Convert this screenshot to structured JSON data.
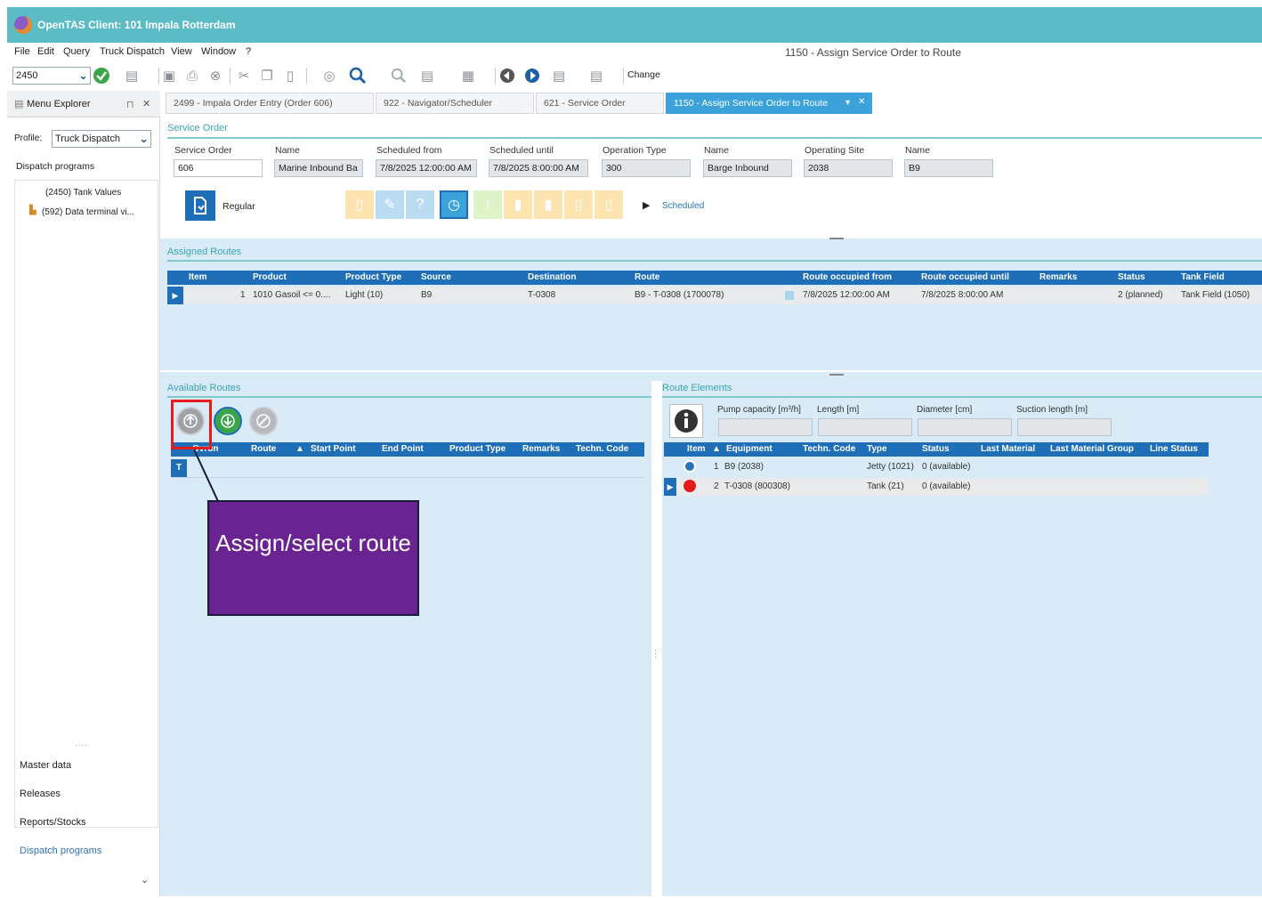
{
  "window": {
    "title": "OpenTAS  Client: 101 Impala Rotterdam"
  },
  "menu": {
    "items": [
      "File",
      "Edit",
      "Query",
      "Truck Dispatch",
      "View",
      "Window",
      "?"
    ],
    "document_title": "1150 - Assign Service Order to Route"
  },
  "toolbar": {
    "combo_value": "2450",
    "change_label": "Change"
  },
  "left_panel": {
    "title": "Menu Explorer",
    "profile_label": "Profile:",
    "profile_value": "Truck Dispatch",
    "section": "Dispatch programs",
    "tree_items": [
      "(2450) Tank Values",
      "(592) Data terminal vi..."
    ],
    "nav_items": [
      "Master data",
      "Releases",
      "Reports/Stocks",
      "Dispatch programs"
    ]
  },
  "tabs": [
    {
      "label": "2499 - Impala Order Entry (Order 606)"
    },
    {
      "label": "922 - Navigator/Scheduler"
    },
    {
      "label": "621 - Service Order"
    },
    {
      "label": "1150 - Assign Service Order to Route"
    }
  ],
  "service_order": {
    "section_label": "Service Order",
    "fields": [
      {
        "label": "Service Order",
        "value": "606"
      },
      {
        "label": "Name",
        "value": "Marine Inbound Ba"
      },
      {
        "label": "Scheduled from",
        "value": "7/8/2025 12:00:00 AM"
      },
      {
        "label": "Scheduled until",
        "value": "7/8/2025 8:00:00 AM"
      },
      {
        "label": "Operation Type",
        "value": "300"
      },
      {
        "label": "Name",
        "value": "Barge Inbound"
      },
      {
        "label": "Operating Site",
        "value": "2038"
      },
      {
        "label": "Name",
        "value": "B9"
      }
    ],
    "type_label": "Regular",
    "status_text": "Scheduled"
  },
  "assigned_routes": {
    "section_label": "Assigned Routes",
    "columns": [
      "Item",
      "Product",
      "Product Type",
      "Source",
      "Destination",
      "Route",
      "Route occupied from",
      "Route occupied until",
      "Remarks",
      "Status",
      "Tank Field"
    ],
    "rows": [
      [
        "1",
        "1010 Gasoil <= 0....",
        "Light (10)",
        "B9",
        "T-0308",
        "B9 - T-0308 (1700078)",
        "7/8/2025 12:00:00 AM",
        "7/8/2025 8:00:00 AM",
        "",
        "2 (planned)",
        "Tank Field (1050)"
      ]
    ]
  },
  "available_routes": {
    "section_label": "Available Routes",
    "columns": [
      "Ovrun",
      "Route",
      "Start Point",
      "End Point",
      "Product Type",
      "Remarks",
      "Techn. Code"
    ]
  },
  "route_elements": {
    "section_label": "Route Elements",
    "info_fields": [
      "Pump capacity [m³/h]",
      "Length [m]",
      "Diameter [cm]",
      "Suction length [m]"
    ],
    "columns": [
      "Item",
      "Equipment",
      "Techn. Code",
      "Type",
      "Status",
      "Last Material",
      "Last Material Group",
      "Line Status"
    ],
    "rows": [
      [
        "1",
        "B9 (2038)",
        "",
        "Jetty (1021)",
        "0 (available)",
        "",
        "",
        ""
      ],
      [
        "2",
        "T-0308 (800308)",
        "",
        "Tank (21)",
        "0 (available)",
        "",
        "",
        ""
      ]
    ]
  },
  "callout": {
    "text": "Assign/select route"
  },
  "colors": {
    "titlebar": "#5bbcc6",
    "grid_header": "#1e6fb8",
    "callout": "#6a2492",
    "highlight": "#e31b1b"
  }
}
